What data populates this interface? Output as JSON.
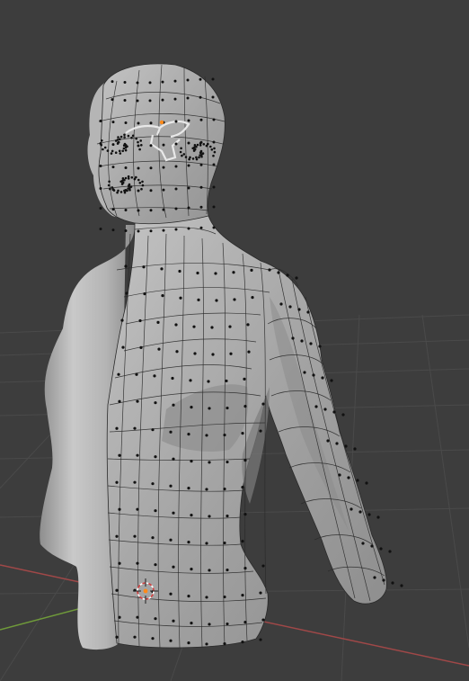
{
  "app": {},
  "viewport": {
    "background_color": "#3d3d3d",
    "grid_color": "#4a4a4a",
    "x_axis_color": "#b04a4a",
    "y_axis_color": "#6f9a3a",
    "mesh_fill_color": "#a6a6a6",
    "mesh_wire_color": "#2a2a2a",
    "vertex_color": "#0f0f0f",
    "selection_color": "#ffffff",
    "origin_color": "#ff8a1a"
  },
  "scene": {
    "object": "female-torso-mesh",
    "mode_shown": "edit-mode-right-half-subdivided-left-half"
  }
}
